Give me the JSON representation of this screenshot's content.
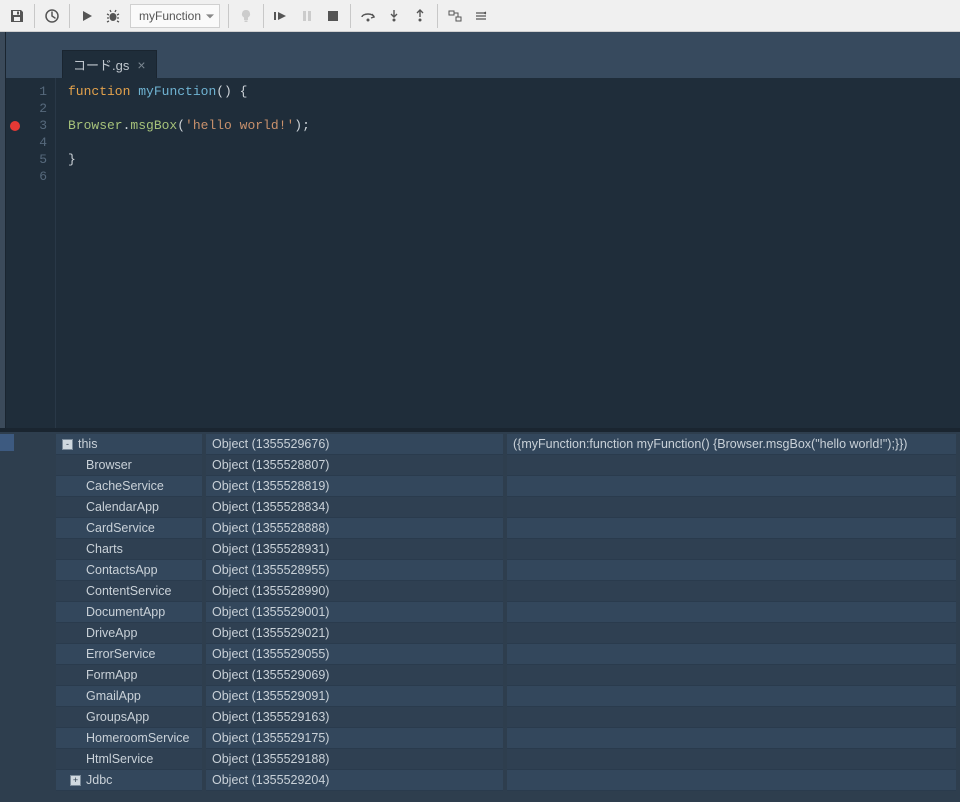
{
  "toolbar": {
    "function_selected": "myFunction"
  },
  "tab": {
    "label": "コード.gs"
  },
  "code": {
    "lines": 6,
    "breakpoint_line": 3,
    "tokens": {
      "l1_kw": "function",
      "l1_name": "myFunction",
      "l1_rest": "() {",
      "l3_obj": "Browser",
      "l3_dot": ".",
      "l3_method": "msgBox",
      "l3_open": "(",
      "l3_str": "'hello world!'",
      "l3_close": ");",
      "l5_brace": "}"
    }
  },
  "debug": {
    "root_label": "this",
    "root_type": "Object (1355529676)",
    "root_value": "({myFunction:function myFunction() {Browser.msgBox(\"hello world!\");}})",
    "vars": [
      {
        "name": "Browser",
        "type": "Object (1355528807)"
      },
      {
        "name": "CacheService",
        "type": "Object (1355528819)"
      },
      {
        "name": "CalendarApp",
        "type": "Object (1355528834)"
      },
      {
        "name": "CardService",
        "type": "Object (1355528888)"
      },
      {
        "name": "Charts",
        "type": "Object (1355528931)"
      },
      {
        "name": "ContactsApp",
        "type": "Object (1355528955)"
      },
      {
        "name": "ContentService",
        "type": "Object (1355528990)"
      },
      {
        "name": "DocumentApp",
        "type": "Object (1355529001)"
      },
      {
        "name": "DriveApp",
        "type": "Object (1355529021)"
      },
      {
        "name": "ErrorService",
        "type": "Object (1355529055)"
      },
      {
        "name": "FormApp",
        "type": "Object (1355529069)"
      },
      {
        "name": "GmailApp",
        "type": "Object (1355529091)"
      },
      {
        "name": "GroupsApp",
        "type": "Object (1355529163)"
      },
      {
        "name": "HomeroomService",
        "type": "Object (1355529175)"
      },
      {
        "name": "HtmlService",
        "type": "Object (1355529188)"
      },
      {
        "name": "Jdbc",
        "type": "Object (1355529204)",
        "expander": "+"
      }
    ]
  }
}
